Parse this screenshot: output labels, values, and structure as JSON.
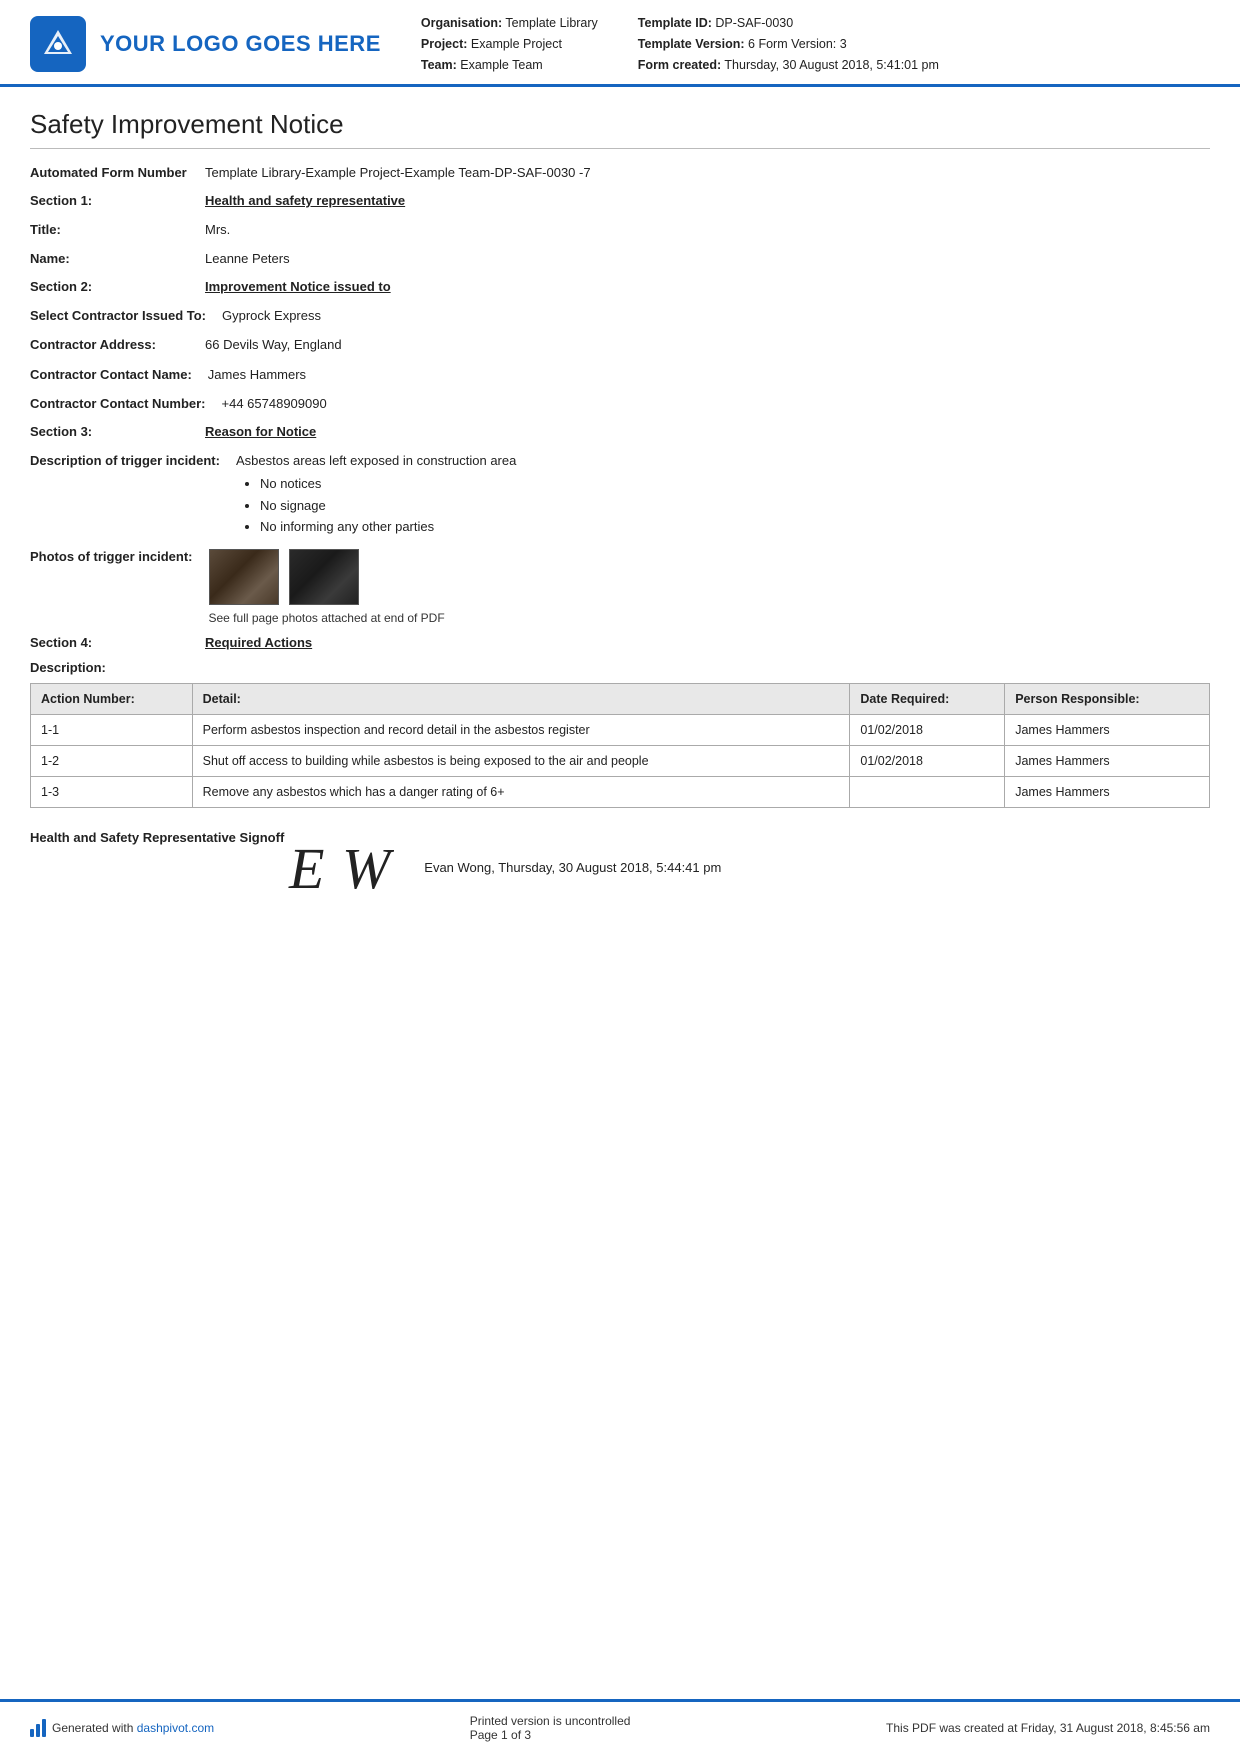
{
  "header": {
    "logo_text": "YOUR LOGO GOES HERE",
    "org_label": "Organisation:",
    "org_value": "Template Library",
    "project_label": "Project:",
    "project_value": "Example Project",
    "team_label": "Team:",
    "team_value": "Example Team",
    "template_id_label": "Template ID:",
    "template_id_value": "DP-SAF-0030",
    "template_version_label": "Template Version:",
    "template_version_value": "6",
    "form_version_label": "Form Version:",
    "form_version_value": "3",
    "form_created_label": "Form created:",
    "form_created_value": "Thursday, 30 August 2018, 5:41:01 pm"
  },
  "doc": {
    "title": "Safety Improvement Notice",
    "auto_form_label": "Automated Form Number",
    "auto_form_value": "Template Library-Example Project-Example Team-DP-SAF-0030  -7",
    "section1_label": "Section 1:",
    "section1_value": "Health and safety representative",
    "title_label": "Title:",
    "title_value": "Mrs.",
    "name_label": "Name:",
    "name_value": "Leanne Peters",
    "section2_label": "Section 2:",
    "section2_value": "Improvement Notice issued to",
    "contractor_label": "Select Contractor Issued To:",
    "contractor_value": "Gyprock Express",
    "contractor_address_label": "Contractor Address:",
    "contractor_address_value": "66 Devils Way, England",
    "contractor_contact_label": "Contractor Contact Name:",
    "contractor_contact_value": "James Hammers",
    "contractor_phone_label": "Contractor Contact Number:",
    "contractor_phone_value": "+44 65748909090",
    "section3_label": "Section 3:",
    "section3_value": "Reason for Notice",
    "trigger_label": "Description of trigger incident:",
    "trigger_main": "Asbestos areas left exposed in construction area",
    "trigger_bullets": [
      "No notices",
      "No signage",
      "No informing any other parties"
    ],
    "photos_label": "Photos of trigger incident:",
    "photos_caption": "See full page photos attached at end of PDF",
    "section4_label": "Section 4:",
    "section4_value": "Required Actions",
    "table_desc_label": "Description:",
    "table_headers": {
      "action_number": "Action Number:",
      "detail": "Detail:",
      "date_required": "Date Required:",
      "person_responsible": "Person Responsible:"
    },
    "table_rows": [
      {
        "action_number": "1-1",
        "detail": "Perform asbestos inspection and record detail in the asbestos register",
        "date_required": "01/02/2018",
        "person_responsible": "James Hammers"
      },
      {
        "action_number": "1-2",
        "detail": "Shut off access to building while asbestos is being exposed to the air and people",
        "date_required": "01/02/2018",
        "person_responsible": "James Hammers"
      },
      {
        "action_number": "1-3",
        "detail": "Remove any asbestos which has a danger rating of 6+",
        "date_required": "",
        "person_responsible": "James Hammers"
      }
    ],
    "signoff_label": "Health and Safety Representative Signoff",
    "signoff_name": "Evan Wong, Thursday, 30 August 2018, 5:44:41 pm",
    "signature_text": "E W"
  },
  "footer": {
    "brand_text": "Generated with",
    "brand_link": "dashpivot.com",
    "middle_text": "Printed version is uncontrolled",
    "page_text": "Page 1 of 3",
    "right_text": "This PDF was created at Friday, 31 August 2018, 8:45:56 am"
  }
}
